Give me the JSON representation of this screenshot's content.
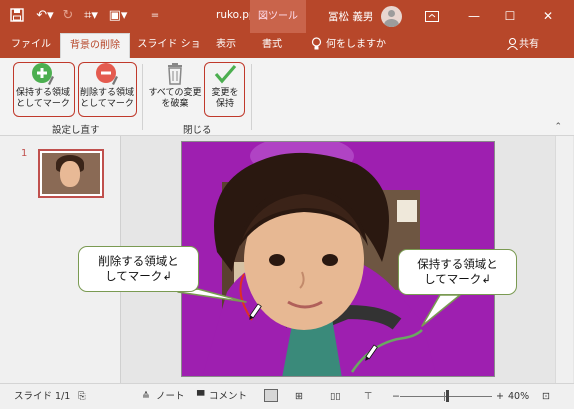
{
  "titlebar": {
    "file_name": "ruko.ppt…",
    "context_tab": "図ツール",
    "user_name": "冨松 義男"
  },
  "tabs": {
    "file": "ファイル",
    "background_removal": "背景の削除",
    "slideshow": "スライド ショー",
    "view": "表示",
    "format": "書式",
    "tell_me": "何をしますか",
    "share": "共有"
  },
  "ribbon": {
    "mark_keep_line1": "保持する領域",
    "mark_keep_line2": "としてマーク",
    "mark_remove_line1": "削除する領域",
    "mark_remove_line2": "としてマーク",
    "discard_line1": "すべての変更",
    "discard_line2": "を破棄",
    "keep_changes_line1": "変更を",
    "keep_changes_line2": "保持",
    "group_refine": "設定し直す",
    "group_close": "閉じる"
  },
  "thumbnail": {
    "number": "1"
  },
  "callouts": {
    "remove_line1": "削除する領域と",
    "remove_line2": "してマーク↲",
    "keep_line1": "保持する領域と",
    "keep_line2": "してマーク↲"
  },
  "statusbar": {
    "slide_counter": "スライド 1/1",
    "notes": "ノート",
    "comments": "コメント",
    "zoom_minus": "−",
    "zoom_plus": "+",
    "zoom_level": "40%"
  },
  "colors": {
    "accent": "#b7472a",
    "removal_overlay": "#9e1fb0",
    "callout_border": "#7a9a52",
    "highlight_outline": "#c0392b"
  }
}
